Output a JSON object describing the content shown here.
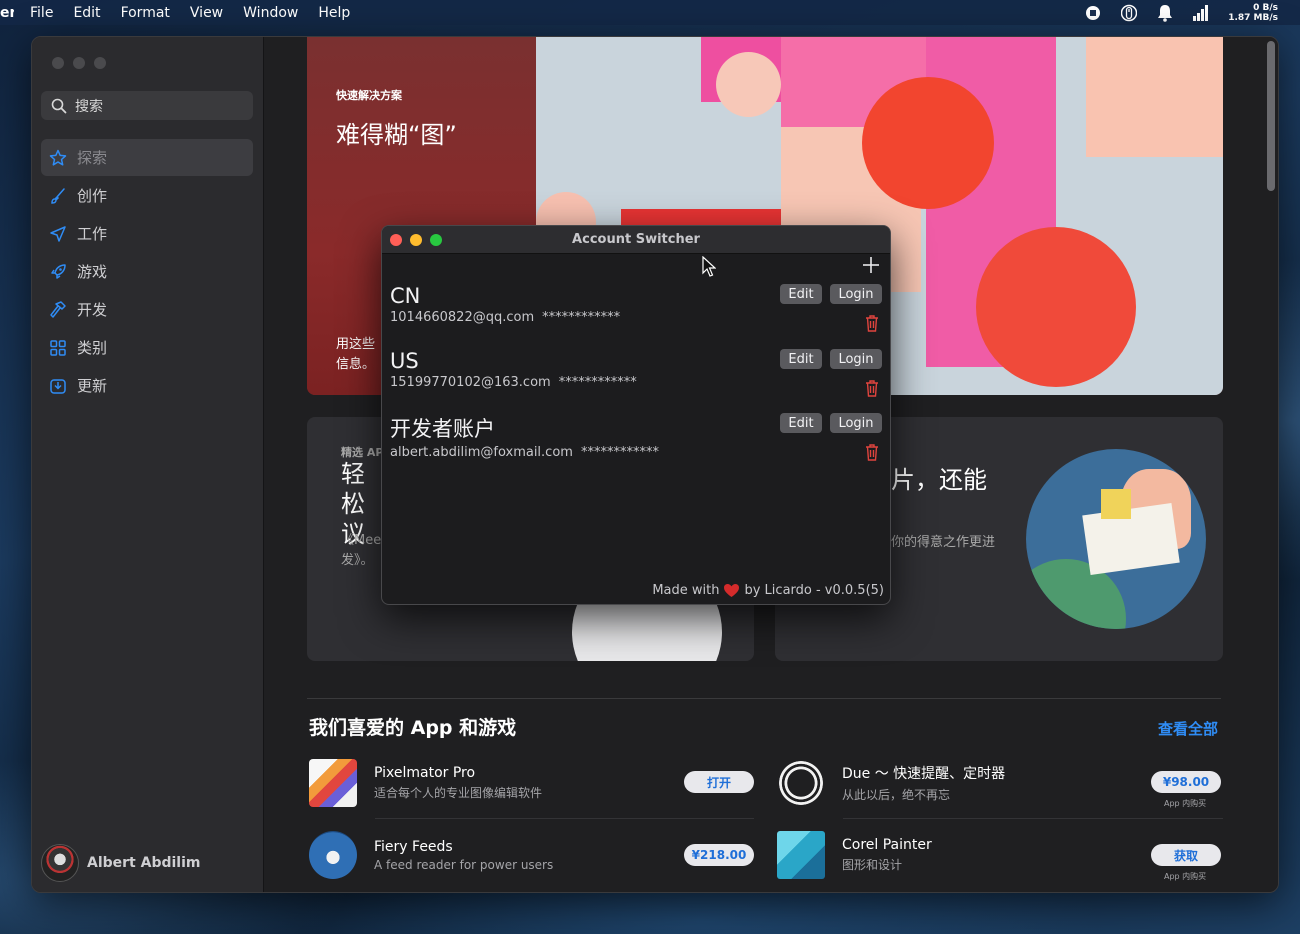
{
  "menubar": {
    "app_name": "er",
    "items": [
      "File",
      "Edit",
      "Format",
      "View",
      "Window",
      "Help"
    ],
    "net_up": "0 B/s",
    "net_down": "1.87 MB/s"
  },
  "sidebar": {
    "search_placeholder": "搜索",
    "items": [
      {
        "label": "探索",
        "icon": "star-icon",
        "active": true
      },
      {
        "label": "创作",
        "icon": "brush-icon"
      },
      {
        "label": "工作",
        "icon": "paper-plane-icon"
      },
      {
        "label": "游戏",
        "icon": "rocket-icon"
      },
      {
        "label": "开发",
        "icon": "hammer-icon"
      },
      {
        "label": "类别",
        "icon": "grid-icon"
      },
      {
        "label": "更新",
        "icon": "download-icon"
      }
    ],
    "user_name": "Albert Abdilim"
  },
  "hero": {
    "kicker": "快速解决方案",
    "title": "难得糊“图”",
    "desc_line1": "用这些",
    "desc_line2": "信息。"
  },
  "card1": {
    "kicker": "精选 AP",
    "title_line1": "轻松",
    "title_line2": "议",
    "desc_line1": "《Mee",
    "desc_line2": "发》。"
  },
  "card2": {
    "title": "片，还能",
    "desc": "你的得意之作更进"
  },
  "section": {
    "title": "我们喜爱的 App 和游戏",
    "see_all": "查看全部",
    "apps": [
      {
        "name": "Pixelmator Pro",
        "sub": "适合每个人的专业图像编辑软件",
        "button": "打开",
        "icon": "pixelmator-icon"
      },
      {
        "name": "Due ～ 快速提醒、定时器",
        "sub": "从此以后，绝不再忘",
        "button": "¥98.00",
        "iap": "App 内购买",
        "icon": "due-icon"
      },
      {
        "name": "Fiery Feeds",
        "sub": "A feed reader for power users",
        "button": "¥218.00",
        "icon": "fiery-feeds-icon"
      },
      {
        "name": "Corel Painter",
        "sub": "图形和设计",
        "button": "获取",
        "iap": "App 内购买",
        "icon": "corel-painter-icon"
      }
    ]
  },
  "switcher": {
    "title": "Account Switcher",
    "edit_label": "Edit",
    "login_label": "Login",
    "accounts": [
      {
        "name": "CN",
        "email": "1014660822@qq.com",
        "password": "************"
      },
      {
        "name": "US",
        "email": "15199770102@163.com",
        "password": "************"
      },
      {
        "name": "开发者账户",
        "email": "albert.abdilim@foxmail.com",
        "password": "************"
      }
    ],
    "footer_prefix": "Made with",
    "footer_suffix": "by Licardo - v0.0.5(5)"
  },
  "colors": {
    "accent": "#2f8cf5",
    "close": "#ff5f57",
    "minimize": "#febc2e",
    "zoom": "#28c840",
    "trash": "#e0443e"
  }
}
